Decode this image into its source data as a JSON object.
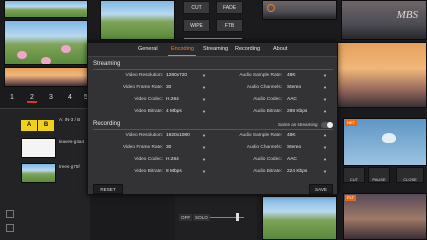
{
  "background": {
    "transition_buttons": [
      "CUT",
      "FADE",
      "WIPE",
      "FTB"
    ],
    "scene_numbers": [
      "1",
      "2",
      "3",
      "4",
      "5"
    ],
    "selected_scene": "2",
    "ab_labels": [
      "A",
      "B"
    ],
    "layer_title": "A: IN-3 / B",
    "list_items": [
      "leaves-g4a4",
      "trees-g75f"
    ],
    "mbs_watermark": "MBS",
    "preview_badges": [
      "NET",
      "PLT"
    ],
    "controls": [
      "CUT",
      "PAUSE",
      "CLOSE"
    ],
    "audio_labels": [
      "OFF",
      "SOLO"
    ]
  },
  "dialog": {
    "tabs": [
      "General",
      "Encoding",
      "Streaming",
      "Recording",
      "About"
    ],
    "active_tab": "Encoding",
    "streaming": {
      "title": "Streaming",
      "video_resolution_label": "Video Resolution:",
      "video_resolution": "1280x720",
      "video_frame_rate_label": "Video Frame Rate:",
      "video_frame_rate": "30",
      "video_codec_label": "Video Codec:",
      "video_codec": "H.264",
      "video_bitrate_label": "Video Bitrate:",
      "video_bitrate": "4 Mbps",
      "audio_sample_rate_label": "Audio Sample Rate:",
      "audio_sample_rate": "48K",
      "audio_channels_label": "Audio Channels:",
      "audio_channels": "Stereo",
      "audio_codec_label": "Audio Codec:",
      "audio_codec": "AAC",
      "audio_bitrate_label": "Audio Bitrate:",
      "audio_bitrate": "288 Kbps"
    },
    "recording": {
      "title": "Recording",
      "same_as_streaming": "Same as streaming",
      "video_resolution_label": "Video Resolution:",
      "video_resolution": "1920x1080",
      "video_frame_rate_label": "Video Frame Rate:",
      "video_frame_rate": "30",
      "video_codec_label": "Video Codec:",
      "video_codec": "H.264",
      "video_bitrate_label": "Video Bitrate:",
      "video_bitrate": "8 Mbps",
      "audio_sample_rate_label": "Audio Sample Rate:",
      "audio_sample_rate": "48K",
      "audio_channels_label": "Audio Channels:",
      "audio_channels": "Stereo",
      "audio_codec_label": "Audio Codec:",
      "audio_codec": "AAC",
      "audio_bitrate_label": "Audio Bitrate:",
      "audio_bitrate": "224 Kbps"
    },
    "reset_label": "RESET",
    "save_label": "SAVE",
    "dropdown_glyph": "▼"
  },
  "colors": {
    "accent": "#e8801f",
    "bg": "#1b1b1d",
    "dialog": "#333336"
  }
}
